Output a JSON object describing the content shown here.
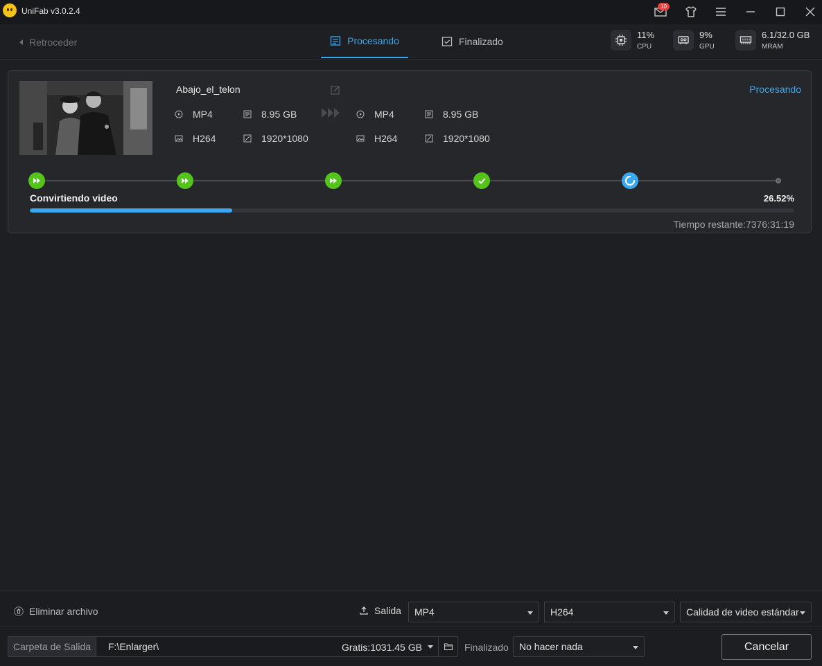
{
  "window": {
    "title": "UniFab v3.0.2.4",
    "notification_count": "10",
    "icons": [
      "mail-icon",
      "shirt-icon",
      "menu-icon",
      "minimize-icon",
      "maximize-icon",
      "close-icon"
    ]
  },
  "nav": {
    "back_label": "Retroceder",
    "tabs": [
      {
        "label": "Procesando",
        "active": true
      },
      {
        "label": "Finalizado",
        "active": false
      }
    ],
    "stats": [
      {
        "value": "11%",
        "label": "CPU",
        "icon": "cpu-icon"
      },
      {
        "value": "9%",
        "label": "GPU",
        "icon": "gpu-icon"
      },
      {
        "value": "6.1/32.0 GB",
        "label": "MRAM",
        "icon": "memory-icon"
      }
    ]
  },
  "task": {
    "file_name": "Abajo_el_telon",
    "status": "Procesando",
    "input": {
      "container": "MP4",
      "size": "8.95 GB",
      "codec": "H264",
      "resolution": "1920*1080"
    },
    "output": {
      "container": "MP4",
      "size": "8.95 GB",
      "codec": "H264",
      "resolution": "1920*1080"
    },
    "steps": [
      "done",
      "done",
      "done",
      "done",
      "current",
      "pending"
    ],
    "stage_label": "Convirtiendo video",
    "progress_text": "26.52%",
    "progress_fraction": 0.2652,
    "remaining": "Tiempo restante:7376:31:19"
  },
  "bottom": {
    "delete_label": "Eliminar archivo",
    "output_label": "Salida",
    "format_value": "MP4",
    "codec_value": "H264",
    "quality_value": "Calidad de video estándar",
    "folder_label": "Carpeta de Salida",
    "folder_path": "F:\\Enlarger\\",
    "free_space": "Gratis:1031.45 GB",
    "finished_label": "Finalizado",
    "finished_action": "No hacer nada",
    "cancel_label": "Cancelar"
  },
  "colors": {
    "accent": "#3aa8f0",
    "success": "#52c41a",
    "badge": "#e5413d",
    "background": "#1e1f23"
  }
}
